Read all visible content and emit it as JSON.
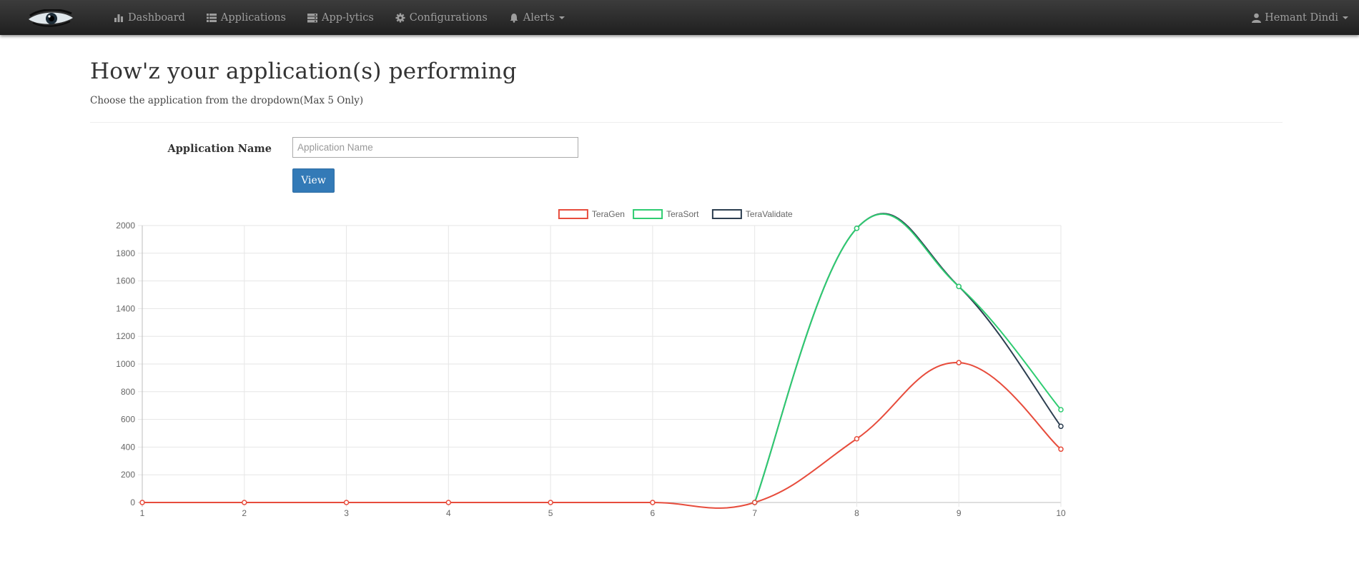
{
  "navbar": {
    "brand_icon": "eye-logo",
    "items": [
      {
        "label": "Dashboard",
        "icon": "bar-chart-icon"
      },
      {
        "label": "Applications",
        "icon": "list-icon"
      },
      {
        "label": "App-lytics",
        "icon": "server-icon"
      },
      {
        "label": "Configurations",
        "icon": "gear-icon"
      },
      {
        "label": "Alerts",
        "icon": "bell-icon",
        "dropdown": true
      }
    ],
    "user": {
      "label": "Hemant Dindi",
      "icon": "user-icon",
      "dropdown": true
    }
  },
  "page": {
    "title": "How'z your application(s) performing",
    "subtitle": "Choose the application from the dropdown(Max 5 Only)"
  },
  "form": {
    "label": "Application Name",
    "placeholder": "Application Name",
    "value": "",
    "button": "View"
  },
  "colors": {
    "navbar": "#222222",
    "primary_button": "#337ab7",
    "teragen": "#e74c3c",
    "terasort": "#2ecc71",
    "teravalidate": "#2c3e50"
  },
  "chart_data": {
    "type": "line",
    "x": [
      "1",
      "2",
      "3",
      "4",
      "5",
      "6",
      "7",
      "8",
      "9",
      "10"
    ],
    "ylim": [
      0,
      2000
    ],
    "yticks": [
      "0",
      "200",
      "400",
      "600",
      "800",
      "1000",
      "1200",
      "1400",
      "1600",
      "1800",
      "2000"
    ],
    "grid": true,
    "legend_position": "top",
    "series": [
      {
        "name": "TeraGen",
        "color": "#e74c3c",
        "values": [
          0,
          0,
          0,
          0,
          0,
          0,
          0,
          460,
          1010,
          385
        ]
      },
      {
        "name": "TeraSort",
        "color": "#2ecc71",
        "values": [
          null,
          null,
          null,
          null,
          null,
          null,
          0,
          1980,
          1560,
          670
        ]
      },
      {
        "name": "TeraValidate",
        "color": "#2c3e50",
        "values": [
          null,
          null,
          null,
          null,
          null,
          null,
          0,
          1980,
          1560,
          550
        ]
      }
    ]
  }
}
